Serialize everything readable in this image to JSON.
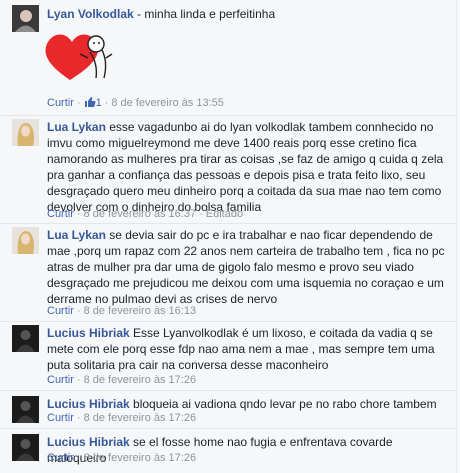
{
  "comments": [
    {
      "author": "Lyan Volkodlak",
      "text": " - minha linda e perfeitinha",
      "actions": {
        "reply": "Curtir",
        "likes": "1",
        "sep": "·",
        "date": "8 de fevereiro às 13:55",
        "edited": ""
      }
    },
    {
      "author": "Lua Lykan",
      "text": " esse vagadunbo ai do lyan volkodlak tambem connhecido no imvu como miguelreymond me deve 1400 reais porq esse cretino fica namorando as mulheres pra tirar as coisas ,se faz de amigo q cuida q zela pra ganhar a confiança das pessoas e depois pisa e trata feito lixo, seu desgraçado quero meu dinheiro porq a coitada da sua mae nao tem como devolver com o dinheiro do bolsa familia",
      "actions": {
        "reply": "Curtir",
        "sep": "·",
        "date": "8 de fevereiro às 16:37",
        "edited": "Editado"
      }
    },
    {
      "author": "Lua Lykan",
      "text": " se devia sair do pc e ira trabalhar e nao ficar dependendo de mae ,porq um rapaz com 22 anos nem carteira de trabalho tem , fica no pc atras de mulher pra dar uma de gigolo falo mesmo e provo seu viado desgraçado me prejudicou me deixou com uma isquemia no coraçao e um derrame no pulmao devi as crises de nervo",
      "actions": {
        "reply": "Curtir",
        "sep": "·",
        "date": "8 de fevereiro às 16:13"
      }
    },
    {
      "author": "Lucius Hibriak",
      "text": " Esse Lyanvolkodlak é um lixoso, e coitada da vadia q se mete com ele porq esse fdp nao ama nem a mae , mas sempre tem uma puta solitaria pra cair na conversa desse maconheiro",
      "actions": {
        "reply": "Curtir",
        "sep": "·",
        "date": "8 de fevereiro às 17:26"
      }
    },
    {
      "author": "Lucius Hibriak",
      "text": " bloqueia ai vadiona qndo levar pe no rabo chore tambem",
      "actions": {
        "reply": "Curtir",
        "sep": "·",
        "date": "8 de fevereiro às 17:26"
      }
    },
    {
      "author": "Lucius Hibriak",
      "text": " se el fosse home nao fugia e enfrentava covarde maloqueiro",
      "actions": {
        "reply": "Curtir",
        "sep": "·",
        "date": "8 de fevereiro às 17:26"
      }
    }
  ],
  "colors": {
    "link": "#365899",
    "meta": "#90949c",
    "heart": "#e8282b",
    "like": "#4267b2"
  },
  "icons": {
    "sticker": "heart-sticker",
    "like": "thumbs-up-icon"
  }
}
